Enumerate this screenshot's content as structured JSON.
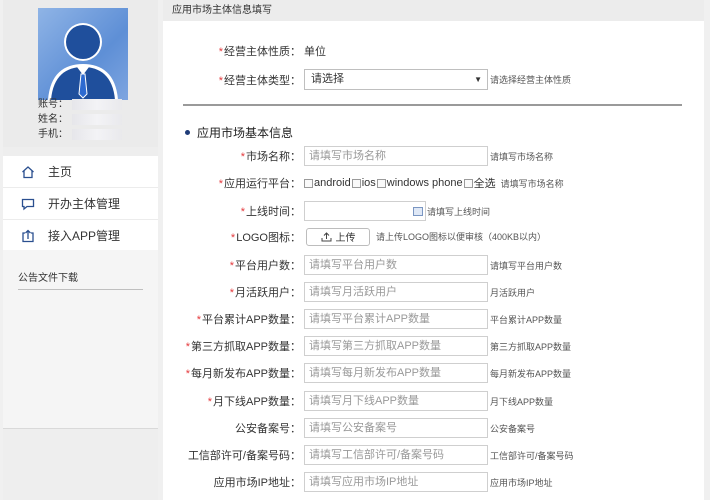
{
  "user": {
    "account_label": "账号：",
    "name_label": "姓名：",
    "phone_label": "手机："
  },
  "nav": {
    "items": [
      {
        "label": "主页",
        "icon": "home-icon"
      },
      {
        "label": "开办主体管理",
        "icon": "chat-icon"
      },
      {
        "label": "接入APP管理",
        "icon": "upload-box-icon"
      }
    ]
  },
  "notice": {
    "title": "公告文件下载"
  },
  "main": {
    "header": "应用市场主体信息填写",
    "entity_nature": {
      "label": "经营主体性质：",
      "value": "单位"
    },
    "entity_type": {
      "label": "经营主体类型：",
      "value": "请选择",
      "hint": "请选择经营主体性质"
    },
    "section_title": "应用市场基本信息",
    "market_name": {
      "label": "市场名称：",
      "placeholder": "请填写市场名称",
      "hint": "请填写市场名称"
    },
    "platform": {
      "label": "应用运行平台：",
      "options": [
        "android",
        "ios",
        "windows phone",
        "全选"
      ],
      "hint": "请填写市场名称"
    },
    "online_time": {
      "label": "上线时间：",
      "hint": "请填写上线时间"
    },
    "logo": {
      "label": "LOGO图标：",
      "button": "上传",
      "hint": "请上传LOGO图标以便审核（400KB以内）"
    },
    "fields": [
      {
        "key": "platform_users",
        "label": "平台用户数：",
        "required": true,
        "placeholder": "请填写平台用户数",
        "hint": "请填写平台用户数"
      },
      {
        "key": "monthly_active",
        "label": "月活跃用户：",
        "required": true,
        "placeholder": "请填写月活跃用户",
        "hint": "月活跃用户"
      },
      {
        "key": "total_apps",
        "label": "平台累计APP数量：",
        "required": true,
        "placeholder": "请填写平台累计APP数量",
        "hint": "平台累计APP数量"
      },
      {
        "key": "third_party_apps",
        "label": "第三方抓取APP数量：",
        "required": true,
        "placeholder": "请填写第三方抓取APP数量",
        "hint": "第三方抓取APP数量"
      },
      {
        "key": "monthly_new_apps",
        "label": "每月新发布APP数量：",
        "required": true,
        "placeholder": "请填写每月新发布APP数量",
        "hint": "每月新发布APP数量"
      },
      {
        "key": "monthly_removed_apps",
        "label": "月下线APP数量：",
        "required": true,
        "placeholder": "请填写月下线APP数量",
        "hint": "月下线APP数量"
      },
      {
        "key": "police_record",
        "label": "公安备案号：",
        "required": false,
        "placeholder": "请填写公安备案号",
        "hint": "公安备案号"
      },
      {
        "key": "miit_license",
        "label": "工信部许可/备案号码：",
        "required": false,
        "placeholder": "请填写工信部许可/备案号码",
        "hint": "工信部许可/备案号码"
      },
      {
        "key": "market_ip",
        "label": "应用市场IP地址：",
        "required": false,
        "placeholder": "请填写应用市场IP地址",
        "hint": "应用市场IP地址"
      }
    ]
  },
  "colors": {
    "required": "#e4393c",
    "section_dot": "#1f3b78",
    "avatar": "#5e8fd6"
  }
}
